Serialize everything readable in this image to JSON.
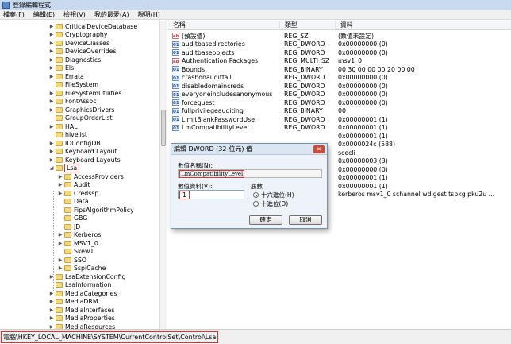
{
  "window": {
    "title": "登錄編輯程式"
  },
  "menu": [
    "檔案(F)",
    "編輯(E)",
    "檢視(V)",
    "我的最愛(A)",
    "說明(H)"
  ],
  "tree": {
    "items": [
      {
        "label": "CriticalDeviceDatabase",
        "expander": "▶"
      },
      {
        "label": "Cryptography",
        "expander": "▶"
      },
      {
        "label": "DeviceClasses",
        "expander": "▶"
      },
      {
        "label": "DeviceOverrides",
        "expander": "▶"
      },
      {
        "label": "Diagnostics",
        "expander": "▶"
      },
      {
        "label": "Els",
        "expander": "▶"
      },
      {
        "label": "Errata",
        "expander": "▶"
      },
      {
        "label": "FileSystem",
        "expander": ""
      },
      {
        "label": "FileSystemUtilities",
        "expander": "▶"
      },
      {
        "label": "FontAssoc",
        "expander": "▶"
      },
      {
        "label": "GraphicsDrivers",
        "expander": "▶"
      },
      {
        "label": "GroupOrderList",
        "expander": ""
      },
      {
        "label": "HAL",
        "expander": "▶"
      },
      {
        "label": "hivelist",
        "expander": ""
      },
      {
        "label": "IDConfigDB",
        "expander": "▶"
      },
      {
        "label": "Keyboard Layout",
        "expander": "▶"
      },
      {
        "label": "Keyboard Layouts",
        "expander": "▶"
      },
      {
        "label": "Lsa",
        "expander": "◢",
        "selected": true
      },
      {
        "label": "AccessProviders",
        "expander": "▶",
        "child": true
      },
      {
        "label": "Audit",
        "expander": "▶",
        "child": true
      },
      {
        "label": "Credssp",
        "expander": "▶",
        "child": true
      },
      {
        "label": "Data",
        "expander": "",
        "child": true
      },
      {
        "label": "FipsAlgorithmPolicy",
        "expander": "",
        "child": true
      },
      {
        "label": "GBG",
        "expander": "",
        "child": true
      },
      {
        "label": "JD",
        "expander": "",
        "child": true
      },
      {
        "label": "Kerberos",
        "expander": "▶",
        "child": true
      },
      {
        "label": "MSV1_0",
        "expander": "▶",
        "child": true
      },
      {
        "label": "Skew1",
        "expander": "",
        "child": true
      },
      {
        "label": "SSO",
        "expander": "▶",
        "child": true
      },
      {
        "label": "SspiCache",
        "expander": "▶",
        "child": true
      },
      {
        "label": "LsaExtensionConfig",
        "expander": "▶"
      },
      {
        "label": "LsaInformation",
        "expander": ""
      },
      {
        "label": "MediaCategories",
        "expander": "▶"
      },
      {
        "label": "MediaDRM",
        "expander": "▶"
      },
      {
        "label": "MediaInterfaces",
        "expander": "▶"
      },
      {
        "label": "MediaProperties",
        "expander": "▶"
      },
      {
        "label": "MediaResources",
        "expander": "▶"
      }
    ]
  },
  "list": {
    "headers": {
      "name": "名稱",
      "type": "類型",
      "data": "資料"
    },
    "rows": [
      {
        "icon": "ab",
        "name": "(預設值)",
        "type": "REG_SZ",
        "data": "(數值未設定)"
      },
      {
        "icon": "bin",
        "name": "auditbasedirectories",
        "type": "REG_DWORD",
        "data": "0x00000000 (0)"
      },
      {
        "icon": "bin",
        "name": "auditbaseobjects",
        "type": "REG_DWORD",
        "data": "0x00000000 (0)"
      },
      {
        "icon": "ab",
        "name": "Authentication Packages",
        "type": "REG_MULTI_SZ",
        "data": "msv1_0"
      },
      {
        "icon": "bin",
        "name": "Bounds",
        "type": "REG_BINARY",
        "data": "00 30 00 00 00 20 00 00"
      },
      {
        "icon": "bin",
        "name": "crashonauditfail",
        "type": "REG_DWORD",
        "data": "0x00000000 (0)"
      },
      {
        "icon": "bin",
        "name": "disabledomaincreds",
        "type": "REG_DWORD",
        "data": "0x00000000 (0)"
      },
      {
        "icon": "bin",
        "name": "everyoneincludesanonymous",
        "type": "REG_DWORD",
        "data": "0x00000000 (0)"
      },
      {
        "icon": "bin",
        "name": "forceguest",
        "type": "REG_DWORD",
        "data": "0x00000000 (0)"
      },
      {
        "icon": "bin",
        "name": "fullprivilegeauditing",
        "type": "REG_BINARY",
        "data": "00"
      },
      {
        "icon": "bin",
        "name": "LimitBlankPasswordUse",
        "type": "REG_DWORD",
        "data": "0x00000001 (1)"
      },
      {
        "icon": "bin",
        "name": "LmCompatibilityLevel",
        "type": "REG_DWORD",
        "data": "0x00000001 (1)"
      },
      {
        "icon": "",
        "name": "",
        "type": "",
        "data": "0x00000001 (1)"
      },
      {
        "icon": "",
        "name": "",
        "type": "",
        "data": "0x0000024c (588)"
      },
      {
        "icon": "",
        "name": "",
        "type": "",
        "data": "scecli"
      },
      {
        "icon": "",
        "name": "",
        "type": "",
        "data": "0x00000003 (3)"
      },
      {
        "icon": "",
        "name": "",
        "type": "",
        "data": "0x00000000 (0)"
      },
      {
        "icon": "",
        "name": "",
        "type": "",
        "data": "0x00000001 (1)"
      },
      {
        "icon": "",
        "name": "",
        "type": "",
        "data": "0x00000001 (1)"
      },
      {
        "icon": "",
        "name": "",
        "type": "",
        "data": "kerberos msv1_0 schannel wdigest tspkg pku2u ..."
      }
    ]
  },
  "dialog": {
    "title": "編輯 DWORD (32-位元) 值",
    "close": "✕",
    "value_name_label": "數值名稱(N):",
    "value_name": "LmCompatibilityLevel",
    "value_data_label": "數值資料(V):",
    "value_data": "1",
    "base_label": "底數",
    "hex_label": "十六進位(H)",
    "dec_label": "十進位(D)",
    "ok": "確定",
    "cancel": "取消"
  },
  "status": {
    "path": "電腦\\HKEY_LOCAL_MACHINE\\SYSTEM\\CurrentControlSet\\Control\\Lsa"
  },
  "colors": {
    "highlight": "#e03030",
    "titlebar": "#c9daee",
    "folder": "#f5d77a"
  }
}
